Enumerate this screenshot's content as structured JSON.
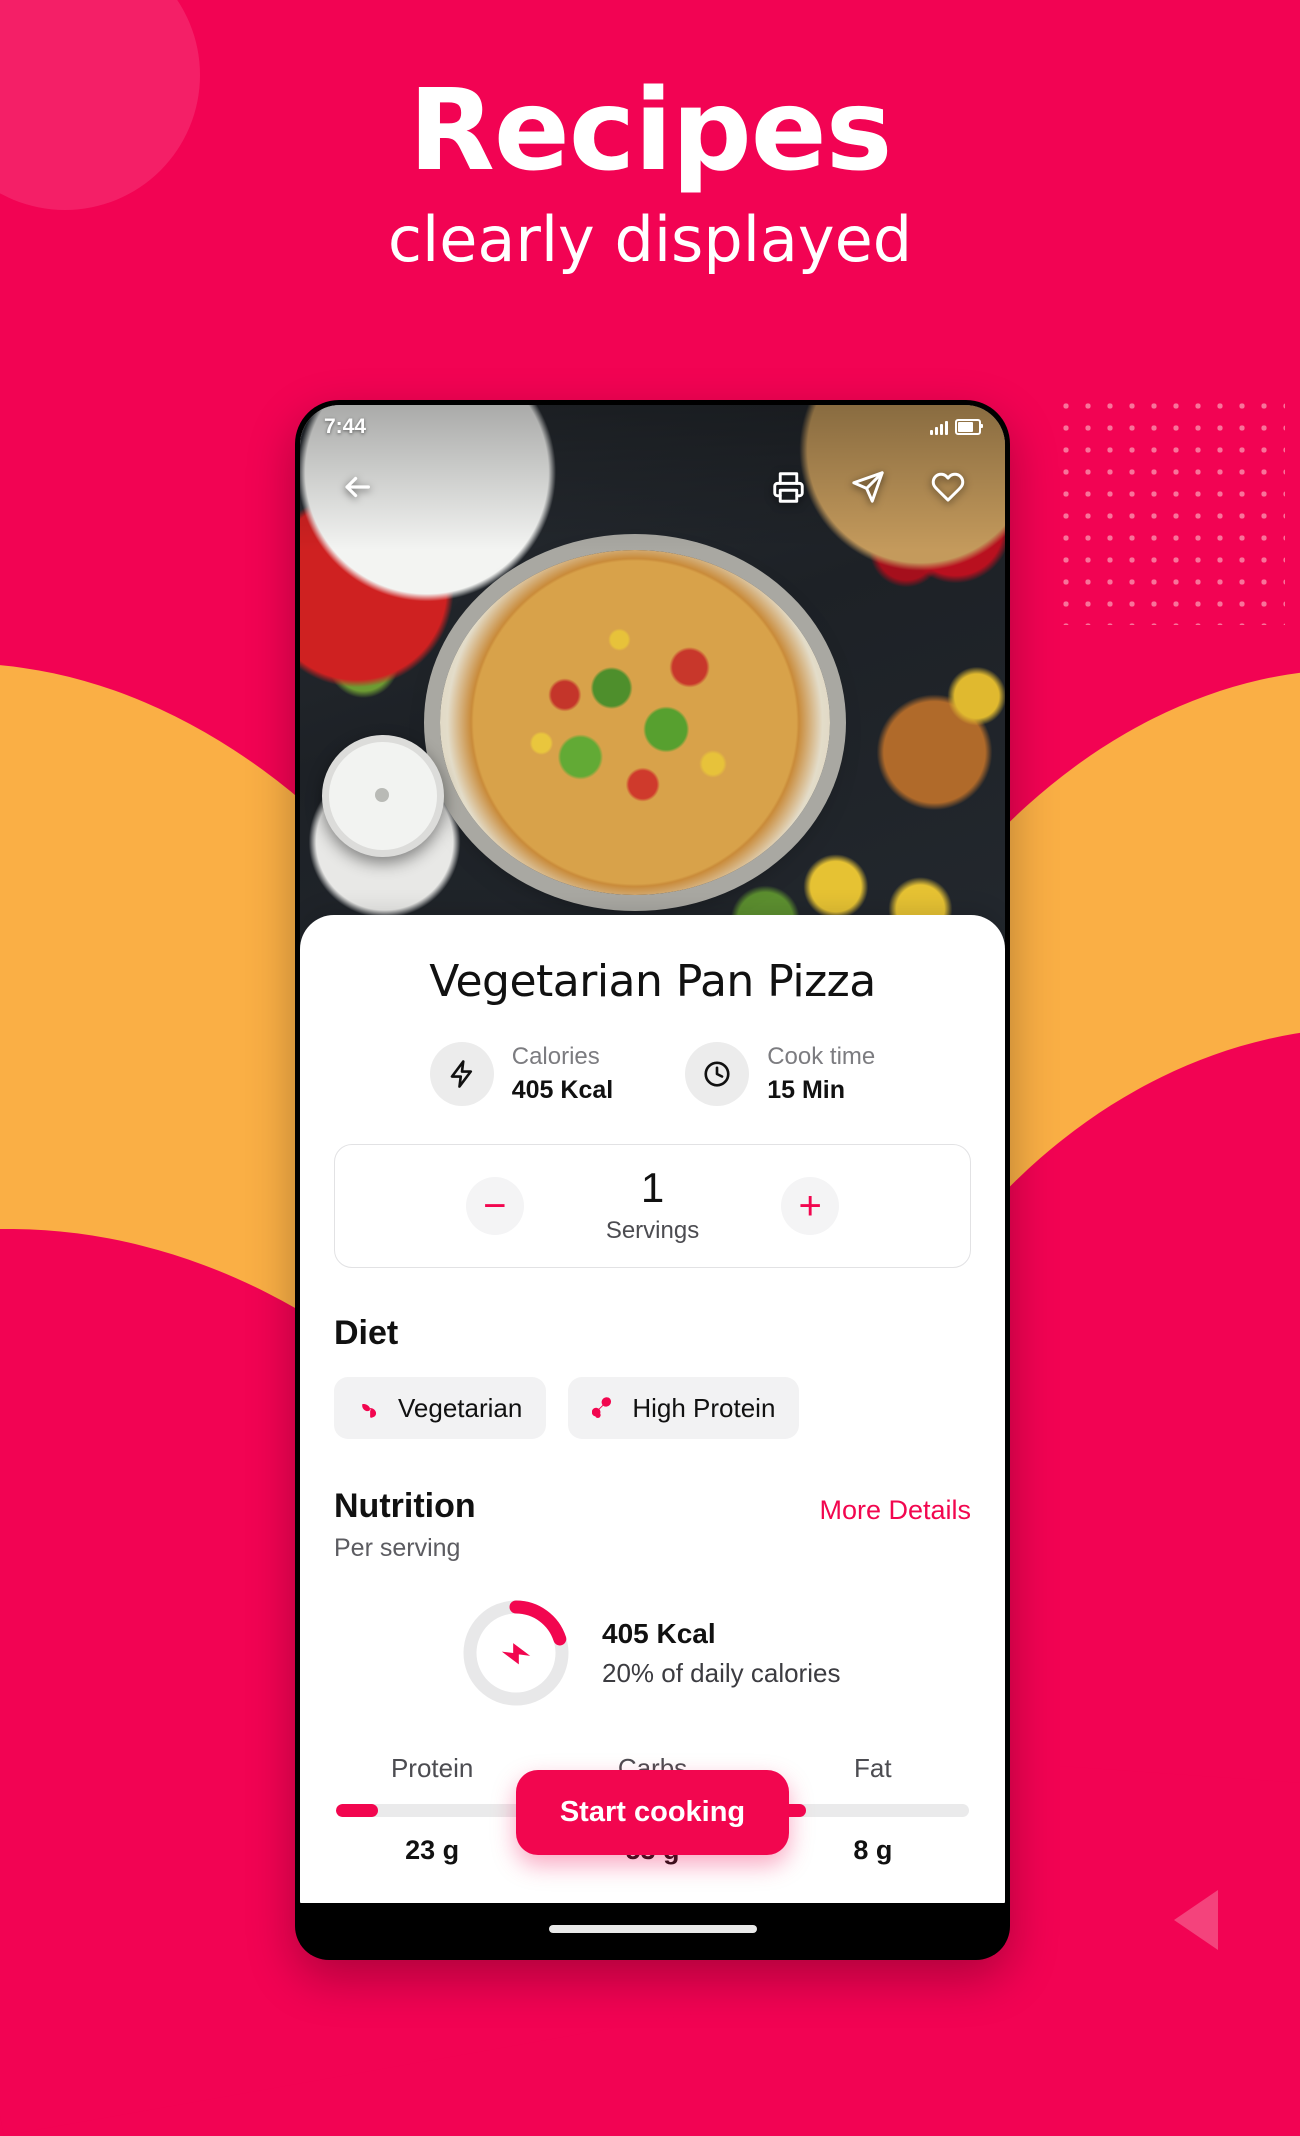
{
  "promo": {
    "headline": "Recipes",
    "subheadline": "clearly displayed",
    "background_color": "#F20353",
    "accent_color": "#FAAF45"
  },
  "phone": {
    "status_bar": {
      "time": "7:44"
    },
    "hero": {
      "back_icon": "arrow-left-icon",
      "print_icon": "printer-icon",
      "share_icon": "share-icon",
      "favorite_icon": "heart-icon"
    }
  },
  "recipe": {
    "title": "Vegetarian Pan Pizza",
    "stats": [
      {
        "icon": "bolt-icon",
        "label": "Calories",
        "value": "405 Kcal"
      },
      {
        "icon": "clock-icon",
        "label": "Cook time",
        "value": "15 Min"
      }
    ],
    "servings": {
      "decrease_label": "−",
      "increase_label": "+",
      "count": "1",
      "caption": "Servings"
    },
    "diet": {
      "heading": "Diet",
      "chips": [
        {
          "icon": "sprout-icon",
          "label": "Vegetarian"
        },
        {
          "icon": "drumstick-icon",
          "label": "High Protein"
        }
      ]
    },
    "nutrition": {
      "heading": "Nutrition",
      "subheading": "Per serving",
      "more_details": "More Details",
      "calories_value": "405 Kcal",
      "calories_note": "20% of daily calories",
      "calories_percent": 20,
      "macros": [
        {
          "label": "Protein",
          "value": "23 g",
          "percent": 22
        },
        {
          "label": "Carbs",
          "value": "53 g",
          "percent": 52
        },
        {
          "label": "Fat",
          "value": "8 g",
          "percent": 15
        }
      ]
    },
    "cta": "Start cooking",
    "accent_color": "#F2064F"
  }
}
